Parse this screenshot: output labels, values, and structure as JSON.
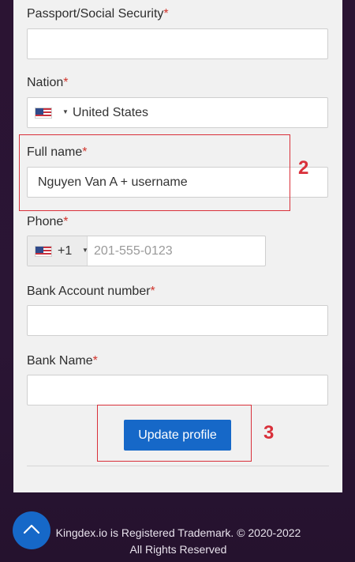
{
  "form": {
    "passport": {
      "label": "Passport/Social Security",
      "required": "*",
      "value": ""
    },
    "nation": {
      "label": "Nation",
      "required": "*",
      "value": "United States",
      "flag_icon": "us-flag-icon"
    },
    "full_name": {
      "label": "Full name",
      "required": "*",
      "value": "Nguyen Van A + username"
    },
    "phone": {
      "label": "Phone",
      "required": "*",
      "country_code": "+1",
      "placeholder": "201-555-0123",
      "flag_icon": "us-flag-icon"
    },
    "bank_account": {
      "label": "Bank Account number",
      "required": "*",
      "value": ""
    },
    "bank_name": {
      "label": "Bank Name",
      "required": "*",
      "value": ""
    },
    "submit_label": "Update profile"
  },
  "annotations": {
    "full_name_marker": "2",
    "submit_marker": "3",
    "color": "#d9303a"
  },
  "footer": {
    "line1": "Kingdex.io is Registered Trademark. © 2020-2022",
    "line2": "All Rights Reserved",
    "scroll_icon": "chevron-up-icon"
  },
  "colors": {
    "accent": "#1668c8",
    "background": "#2a1533",
    "card": "#f1f1f1",
    "required": "#d0342c"
  }
}
